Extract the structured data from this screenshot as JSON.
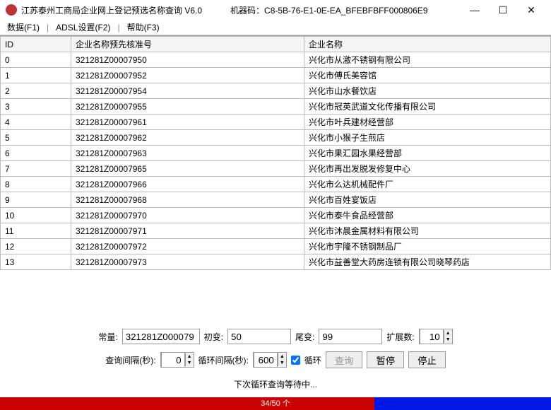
{
  "window": {
    "title": "江苏泰州工商局企业网上登记预选名称查询 V6.0",
    "machine_label": "机器码：",
    "machine_code": "C8-5B-76-E1-0E-EA_BFEBFBFF000806E9",
    "min": "—",
    "max": "☐",
    "close": "✕"
  },
  "menu": {
    "data": "数据(F1)",
    "adsl": "ADSL设置(F2)",
    "help": "帮助(F3)"
  },
  "table": {
    "headers": {
      "id": "ID",
      "regno": "企业名称预先核准号",
      "name": "企业名称"
    },
    "rows": [
      {
        "id": "0",
        "regno": "321281Z00007950",
        "name": "兴化市从激不锈钢有限公司"
      },
      {
        "id": "1",
        "regno": "321281Z00007952",
        "name": "兴化市傅氏美容馆"
      },
      {
        "id": "2",
        "regno": "321281Z00007954",
        "name": "兴化市山水餐饮店"
      },
      {
        "id": "3",
        "regno": "321281Z00007955",
        "name": "兴化市冠英武道文化传播有限公司"
      },
      {
        "id": "4",
        "regno": "321281Z00007961",
        "name": "兴化市叶兵建材经营部"
      },
      {
        "id": "5",
        "regno": "321281Z00007962",
        "name": "兴化市小猴子生煎店"
      },
      {
        "id": "6",
        "regno": "321281Z00007963",
        "name": "兴化市果汇园水果经营部"
      },
      {
        "id": "7",
        "regno": "321281Z00007965",
        "name": "兴化市再出发脱发修复中心"
      },
      {
        "id": "8",
        "regno": "321281Z00007966",
        "name": "兴化市么达机械配件厂"
      },
      {
        "id": "9",
        "regno": "321281Z00007968",
        "name": "兴化市百姓宴饭店"
      },
      {
        "id": "10",
        "regno": "321281Z00007970",
        "name": "兴化市泰牛食品经营部"
      },
      {
        "id": "11",
        "regno": "321281Z00007971",
        "name": "兴化市沐晨金属材料有限公司"
      },
      {
        "id": "12",
        "regno": "321281Z00007972",
        "name": "兴化市宇隆不锈钢制品厂"
      },
      {
        "id": "13",
        "regno": "321281Z00007973",
        "name": "兴化市益善堂大药房连锁有限公司晓琴药店"
      }
    ]
  },
  "controls": {
    "const_label": "常量:",
    "const_value": "321281Z000079",
    "init_label": "初变:",
    "init_value": "50",
    "tail_label": "尾变:",
    "tail_value": "99",
    "expand_label": "扩展数:",
    "expand_value": "10",
    "query_interval_label": "查询间隔(秒):",
    "query_interval_value": "0",
    "loop_interval_label": "循环间隔(秒):",
    "loop_interval_value": "600",
    "loop_checkbox_label": "循环",
    "btn_query": "查询",
    "btn_pause": "暂停",
    "btn_stop": "停止"
  },
  "status": {
    "text": "下次循环查询等待中...",
    "progress_text": "34/50 个",
    "progress_pct": 68
  }
}
